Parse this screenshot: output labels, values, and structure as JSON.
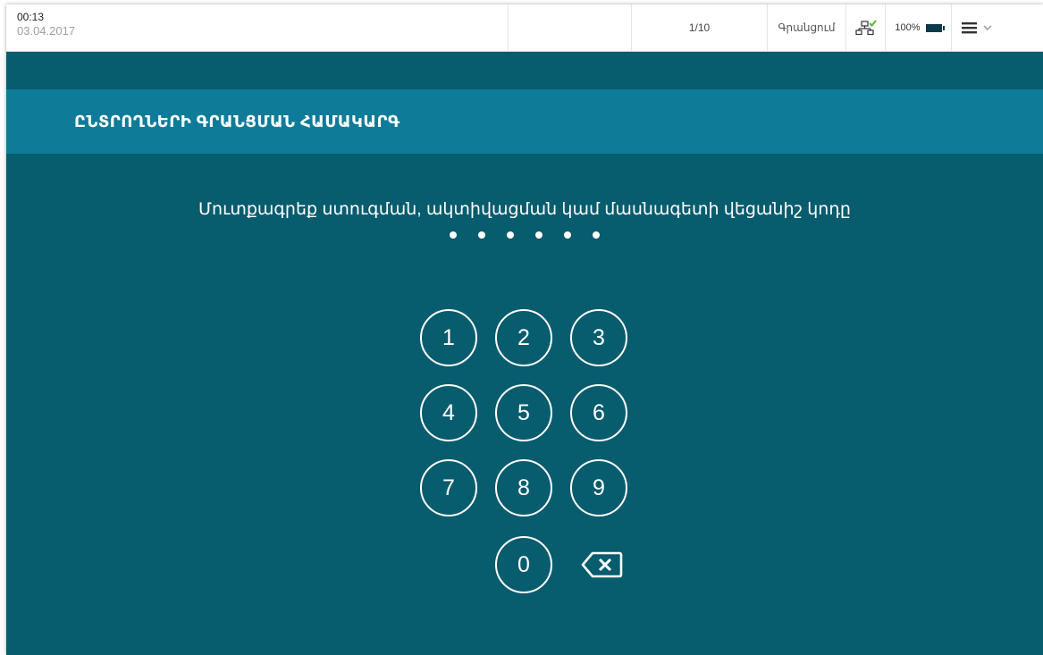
{
  "statusbar": {
    "time": "00:13",
    "date": "03.04.2017",
    "page": "1/10",
    "mode": "Գրանցում",
    "battery": "100%",
    "icons": {
      "network": "network-connected-icon",
      "check": "check-icon",
      "battery": "battery-icon",
      "menu": "hamburger-menu-icon",
      "chevron": "chevron-down-icon"
    }
  },
  "header": {
    "title": "ԸՆՏՐՈՂՆԵՐԻ ԳՐԱՆՑՄԱՆ ՀԱՄԱԿԱՐԳ"
  },
  "main": {
    "prompt": "Մուտքագրեք ստուգման, ակտիվացման կամ մասնագետի վեցանիշ կոդը",
    "pin_length": 6,
    "keys": [
      "1",
      "2",
      "3",
      "4",
      "5",
      "6",
      "7",
      "8",
      "9",
      "0"
    ],
    "backspace_icon": "backspace-icon"
  },
  "colors": {
    "background": "#075c6e",
    "header_band": "#0e7c99",
    "check": "#5cb82e",
    "text": "#ffffff"
  }
}
